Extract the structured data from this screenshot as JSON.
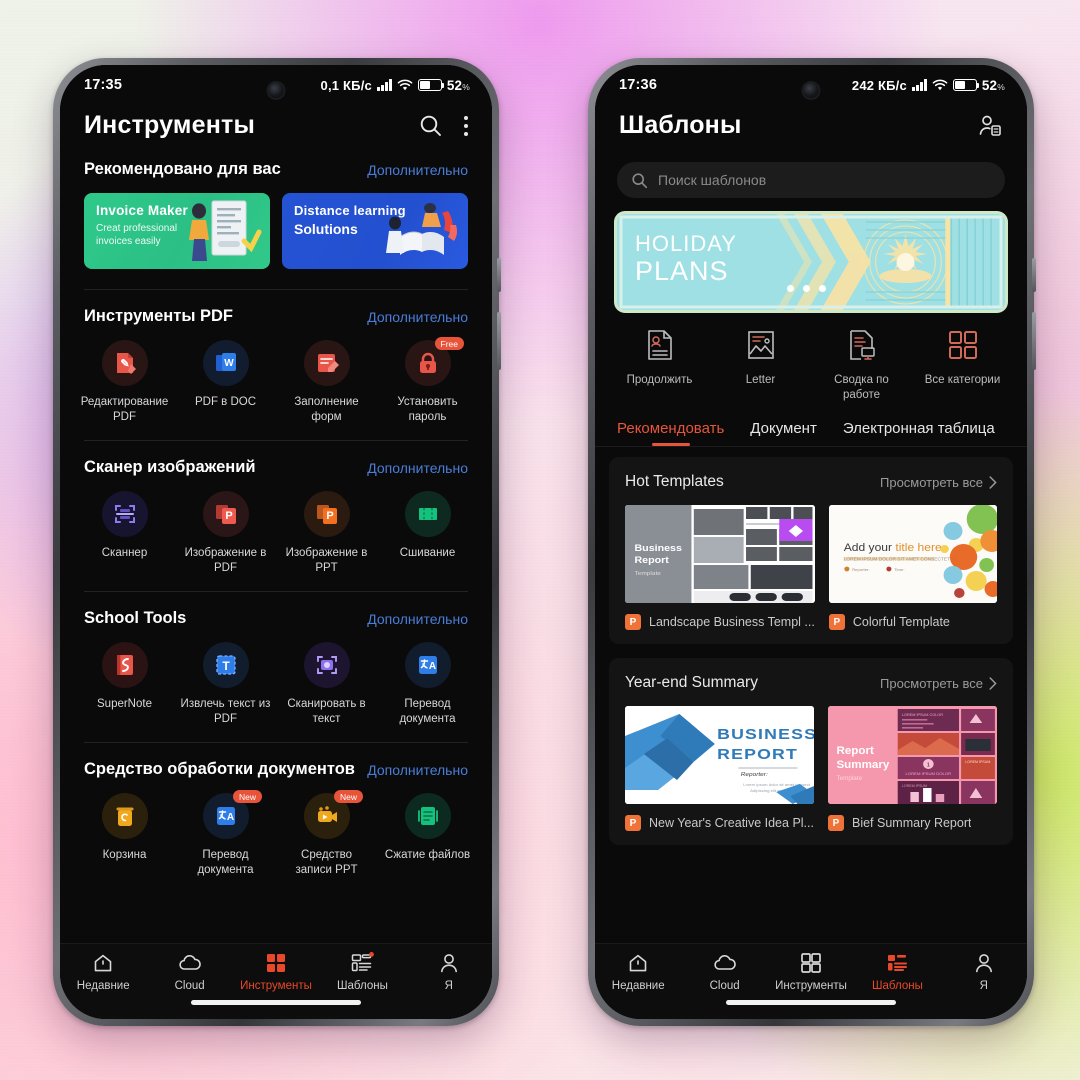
{
  "background": {
    "colors": [
      "#eef2e8",
      "#ee96ee",
      "#c596f0",
      "#ffb9cd",
      "#c8e858",
      "#fce2e8"
    ]
  },
  "accent": {
    "red": "#e8492a",
    "blue_link": "#4a7dd8",
    "badge": "#e8543a"
  },
  "left_phone": {
    "status": {
      "time": "17:35",
      "speed": "0,1 КБ/с",
      "battery": "52",
      "battery_unit": "%"
    },
    "header": {
      "title": "Инструменты",
      "search_icon": "search-icon",
      "menu_icon": "kebab-menu-icon"
    },
    "sections": [
      {
        "title": "Рекомендовано для вас",
        "more": "Дополнительно",
        "type": "banners",
        "banners": [
          {
            "title": "Invoice Maker",
            "subtitle": "Creat professional\ninvoices easily",
            "color": "#2fc98b"
          },
          {
            "title": "Distance learning",
            "subtitle": "Solutions",
            "color": "#2453d4"
          }
        ]
      },
      {
        "title": "Инструменты PDF",
        "more": "Дополнительно",
        "type": "tools",
        "tools": [
          {
            "label": "Редактирование PDF",
            "icon": "pdf-edit-icon",
            "badge": ""
          },
          {
            "label": "PDF в DOC",
            "icon": "pdf-to-doc-icon",
            "badge": ""
          },
          {
            "label": "Заполнение форм",
            "icon": "form-fill-icon",
            "badge": ""
          },
          {
            "label": "Установить пароль",
            "icon": "lock-icon",
            "badge": "Free"
          }
        ]
      },
      {
        "title": "Сканер изображений",
        "more": "Дополнительно",
        "type": "tools",
        "tools": [
          {
            "label": "Сканнер",
            "icon": "scanner-icon",
            "badge": ""
          },
          {
            "label": "Изображение в PDF",
            "icon": "image-to-pdf-icon",
            "badge": ""
          },
          {
            "label": "Изображение в PPT",
            "icon": "image-to-ppt-icon",
            "badge": ""
          },
          {
            "label": "Сшивание",
            "icon": "stitch-icon",
            "badge": ""
          }
        ]
      },
      {
        "title": "School Tools",
        "more": "Дополнительно",
        "type": "tools",
        "tools": [
          {
            "label": "SuperNote",
            "icon": "supernote-icon",
            "badge": ""
          },
          {
            "label": "Извлечь текст из PDF",
            "icon": "extract-text-icon",
            "badge": ""
          },
          {
            "label": "Сканировать в текст",
            "icon": "scan-to-text-icon",
            "badge": ""
          },
          {
            "label": "Перевод документа",
            "icon": "translate-icon",
            "badge": ""
          }
        ]
      },
      {
        "title": "Средство обработки документов",
        "more": "Дополнительно",
        "type": "tools",
        "tools": [
          {
            "label": "Корзина",
            "icon": "trash-icon",
            "badge": ""
          },
          {
            "label": "Перевод документа",
            "icon": "translate-icon",
            "badge": "New"
          },
          {
            "label": "Средство записи PPT",
            "icon": "ppt-record-icon",
            "badge": "New"
          },
          {
            "label": "Сжатие файлов",
            "icon": "compress-icon",
            "badge": ""
          }
        ]
      }
    ],
    "nav": [
      {
        "label": "Недавние",
        "icon": "home-icon",
        "active": false
      },
      {
        "label": "Cloud",
        "icon": "cloud-icon",
        "active": false
      },
      {
        "label": "Инструменты",
        "icon": "grid-icon",
        "active": true
      },
      {
        "label": "Шаблоны",
        "icon": "templates-icon",
        "active": false,
        "dot": true
      },
      {
        "label": "Я",
        "icon": "person-icon",
        "active": false
      }
    ]
  },
  "right_phone": {
    "status": {
      "time": "17:36",
      "speed": "242 КБ/с",
      "battery": "52",
      "battery_unit": "%"
    },
    "header": {
      "title": "Шаблоны",
      "account_icon": "account-card-icon"
    },
    "search": {
      "placeholder": "Поиск шаблонов",
      "icon": "search-icon"
    },
    "banner": {
      "line1": "HOLIDAY",
      "line2": "PLANS",
      "bg": "#9fe0e4",
      "accent": "#f7e3a6"
    },
    "quick_actions": [
      {
        "label": "Продолжить",
        "icon": "resume-doc-icon"
      },
      {
        "label": "Letter",
        "icon": "letter-icon"
      },
      {
        "label": "Сводка по работе",
        "icon": "work-summary-icon"
      },
      {
        "label": "Все категории",
        "icon": "all-categories-icon"
      }
    ],
    "tabs": [
      {
        "label": "Рекомендовать",
        "active": true
      },
      {
        "label": "Документ",
        "active": false
      },
      {
        "label": "Электронная таблица",
        "active": false
      }
    ],
    "cards": [
      {
        "title": "Hot Templates",
        "see_all": "Просмотреть все",
        "items": [
          {
            "name": "Landscape Business Templ ...",
            "kind": "P",
            "thumb": "business-report-grey"
          },
          {
            "name": "Colorful Template",
            "kind": "P",
            "thumb": "colorful-bubbles"
          }
        ]
      },
      {
        "title": "Year-end Summary",
        "see_all": "Просмотреть все",
        "items": [
          {
            "name": "New Year's Creative Idea Pl...",
            "kind": "P",
            "thumb": "business-report-blue"
          },
          {
            "name": "Bief Summary Report",
            "kind": "P",
            "thumb": "report-summary-pink"
          }
        ]
      }
    ],
    "nav": [
      {
        "label": "Недавние",
        "icon": "home-icon",
        "active": false
      },
      {
        "label": "Cloud",
        "icon": "cloud-icon",
        "active": false
      },
      {
        "label": "Инструменты",
        "icon": "grid-icon",
        "active": false
      },
      {
        "label": "Шаблоны",
        "icon": "templates-icon",
        "active": true
      },
      {
        "label": "Я",
        "icon": "person-icon",
        "active": false
      }
    ]
  }
}
